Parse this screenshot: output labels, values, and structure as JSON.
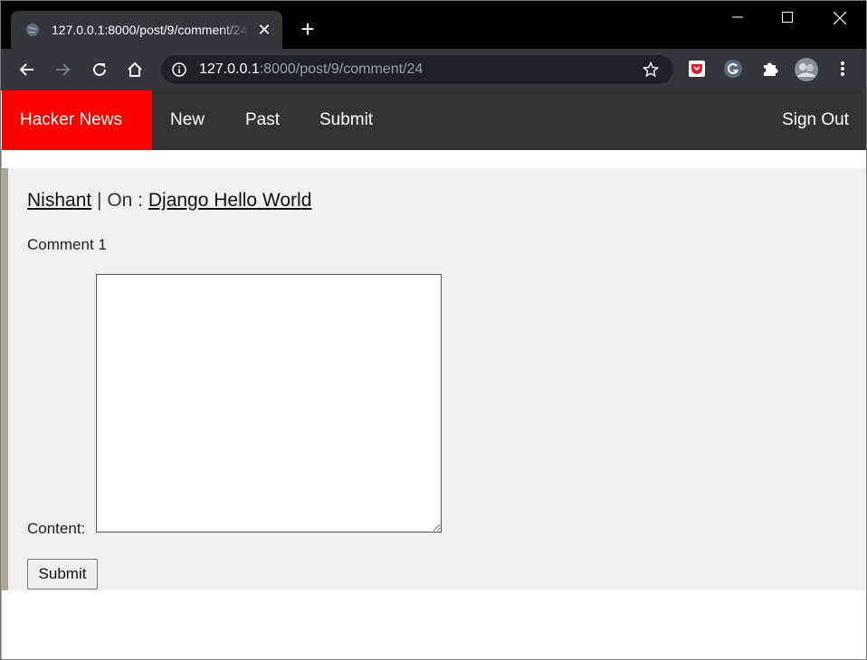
{
  "browser": {
    "tab_title": "127.0.0.1:8000/post/9/comment/24",
    "tab_close": "✕",
    "new_tab": "+",
    "url_host": "127.0.0.1",
    "url_path": ":8000/post/9/comment/24",
    "colors": {
      "titlebar": "#000000",
      "toolbar": "#35363a",
      "omnibox": "#202124"
    },
    "icons": [
      "globe-icon",
      "back-icon",
      "forward-icon",
      "reload-icon",
      "home-icon",
      "info-icon",
      "star-icon",
      "pocket-icon",
      "grammarly-icon",
      "extensions-icon",
      "avatar",
      "menu-icon"
    ]
  },
  "navbar": {
    "brand": "Hacker News",
    "links": [
      "New",
      "Past",
      "Submit"
    ],
    "sign_out": "Sign Out",
    "colors": {
      "background": "#333333",
      "brand_background": "#ff0000"
    }
  },
  "comment": {
    "author": "Nishant",
    "separator": " | On : ",
    "post_title": "Django Hello World",
    "text": "Comment 1"
  },
  "form": {
    "content_label": "Content:",
    "content_value": "",
    "submit_label": "Submit"
  }
}
